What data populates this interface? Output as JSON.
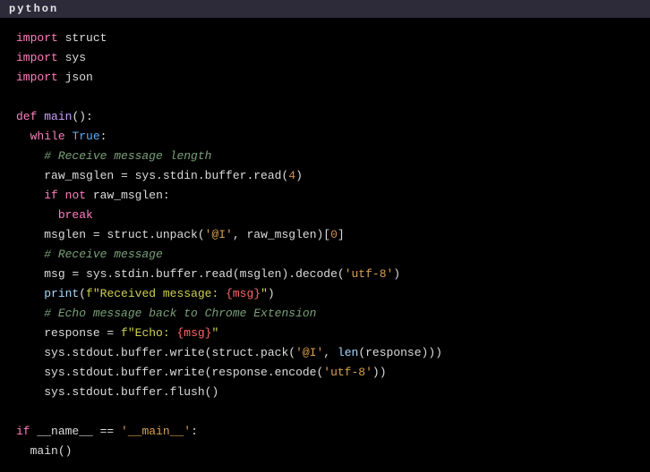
{
  "header": {
    "language": "python"
  },
  "code": {
    "import1_kw": "import",
    "import1_mod": "struct",
    "import2_kw": "import",
    "import2_mod": "sys",
    "import3_kw": "import",
    "import3_mod": "json",
    "def_kw": "def",
    "def_name": "main",
    "def_paren": "():",
    "while_kw": "while",
    "true_lit": "True",
    "colon": ":",
    "c1": "# Receive message length",
    "l1a": "raw_msglen = sys.stdin.buffer.read(",
    "l1n": "4",
    "l1b": ")",
    "if_kw": "if",
    "not_kw": "not",
    "if_var": "raw_msglen:",
    "break_kw": "break",
    "l2a": "msglen = struct.unpack(",
    "l2s": "'@I'",
    "l2b": ", raw_msglen)[",
    "l2n": "0",
    "l2c": "]",
    "c2": "# Receive message",
    "l3a": "msg = sys.stdin.buffer.read(msglen).decode(",
    "l3s": "'utf-8'",
    "l3b": ")",
    "print_fn": "print",
    "l4a": "(",
    "l4f1": "f\"Received message: ",
    "l4i": "{msg}",
    "l4f2": "\"",
    "l4b": ")",
    "c3": "# Echo message back to Chrome Extension",
    "l5a": "response = ",
    "l5f1": "f\"Echo: ",
    "l5i": "{msg}",
    "l5f2": "\"",
    "l6a": "sys.stdout.buffer.write(struct.pack(",
    "l6s": "'@I'",
    "l6b": ", ",
    "len_fn": "len",
    "l6c": "(response)))",
    "l7a": "sys.stdout.buffer.write(response.encode(",
    "l7s": "'utf-8'",
    "l7b": "))",
    "l8": "sys.stdout.buffer.flush()",
    "if2_kw": "if",
    "name_var": "__name__ == ",
    "name_str": "'__main__'",
    "name_colon": ":",
    "call_main": "main()"
  }
}
